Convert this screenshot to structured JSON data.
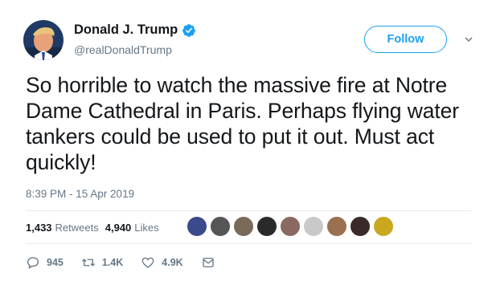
{
  "user": {
    "display_name": "Donald J. Trump",
    "handle": "@realDonaldTrump",
    "verified": true,
    "avatar_icon": "profile-photo"
  },
  "follow_button": {
    "label": "Follow"
  },
  "caret_icon": "chevron-down-icon",
  "tweet": {
    "text": "So horrible to watch the massive fire at Notre Dame Cathedral in Paris. Perhaps flying water tankers could be used to put it out. Must act quickly!",
    "timestamp": "8:39 PM - 15 Apr 2019"
  },
  "stats": {
    "retweets_count": "1,433",
    "retweets_label": "Retweets",
    "likes_count": "4,940",
    "likes_label": "Likes"
  },
  "likers": [
    {
      "name": "liker-avatar-1",
      "color": "#3b4a8a"
    },
    {
      "name": "liker-avatar-2",
      "color": "#555555"
    },
    {
      "name": "liker-avatar-3",
      "color": "#7a6a5a"
    },
    {
      "name": "liker-avatar-4",
      "color": "#2a2a2a"
    },
    {
      "name": "liker-avatar-5",
      "color": "#8a6a60"
    },
    {
      "name": "liker-avatar-6",
      "color": "#c9c9c9"
    },
    {
      "name": "liker-avatar-7",
      "color": "#9a7050"
    },
    {
      "name": "liker-avatar-8",
      "color": "#3a2a2a"
    },
    {
      "name": "liker-avatar-9",
      "color": "#c9a820"
    }
  ],
  "actions": {
    "replies": "945",
    "retweets": "1.4K",
    "likes": "4.9K"
  },
  "colors": {
    "accent": "#1da1f2",
    "text": "#14171a",
    "secondary": "#657786",
    "divider": "#e6ecf0"
  }
}
